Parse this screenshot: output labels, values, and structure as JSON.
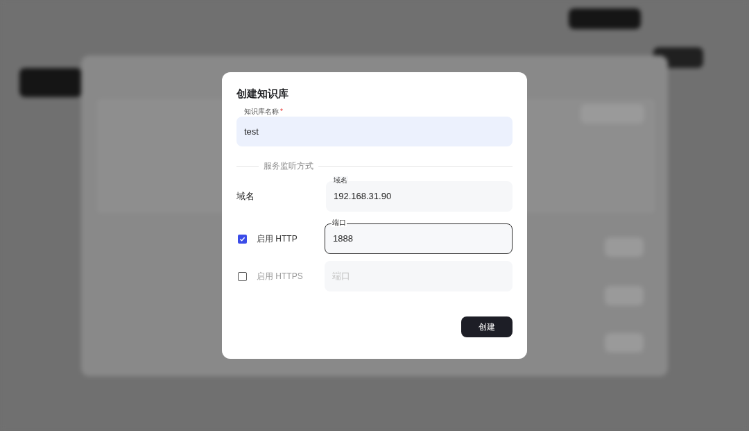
{
  "dialog": {
    "title": "创建知识库",
    "name_field": {
      "label": "知识库名称",
      "required_mark": "*",
      "value": "test"
    },
    "section_label": "服务监听方式",
    "domain": {
      "label": "域名",
      "field_label": "域名",
      "value": "192.168.31.90"
    },
    "protocols": [
      {
        "label": "启用 HTTP",
        "checked": true,
        "field_label": "端口",
        "value": "1888",
        "focused": true
      },
      {
        "label": "启用 HTTPS",
        "checked": false,
        "placeholder": "端口",
        "focused": false
      }
    ],
    "submit": "创建"
  }
}
